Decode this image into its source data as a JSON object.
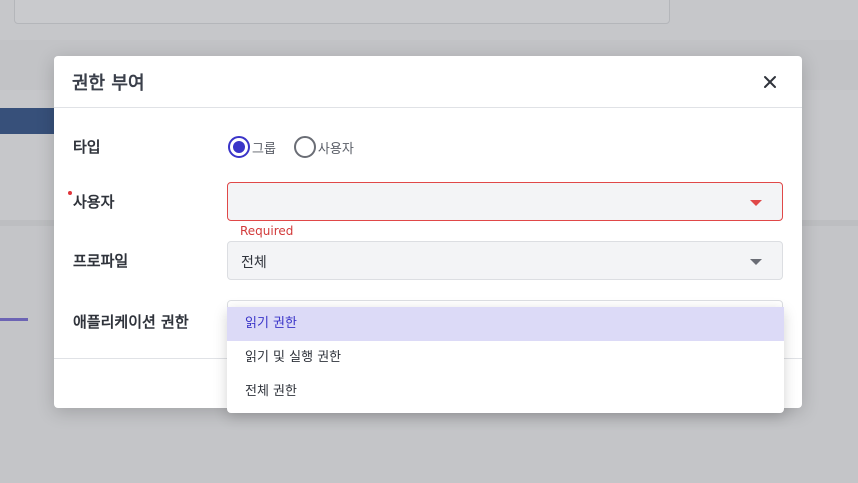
{
  "modal": {
    "title": "권한 부여",
    "close_icon": "close-icon"
  },
  "form": {
    "type_label": "타입",
    "type_options": [
      {
        "label": "그룹",
        "checked": true
      },
      {
        "label": "사용자",
        "checked": false
      }
    ],
    "user_label": "사용자",
    "user_value": "",
    "user_error": "Required",
    "profile_label": "프로파일",
    "profile_value": "전체",
    "app_permission_label": "애플리케이션 권한"
  },
  "menu": {
    "items": [
      {
        "label": "읽기 권한",
        "active": true
      },
      {
        "label": "읽기 및 실행 권한",
        "active": false
      },
      {
        "label": "전체 권한",
        "active": false
      }
    ]
  },
  "colors": {
    "accent": "#3a34c8",
    "error": "#e04848",
    "menu_highlight": "#dcdaf7"
  }
}
